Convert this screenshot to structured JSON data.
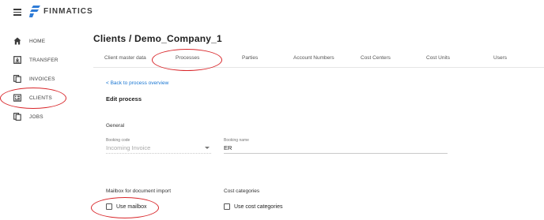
{
  "app": {
    "logo_text": "FINMATICS",
    "menu_icon": "hamburger-menu-icon",
    "logo_icon": "finmatics-logo-icon",
    "brand_color": "#2e7bd6"
  },
  "sidebar": {
    "items": [
      {
        "label": "HOME",
        "icon": "home-icon"
      },
      {
        "label": "TRANSFER",
        "icon": "transfer-icon"
      },
      {
        "label": "INVOICES",
        "icon": "invoices-icon"
      },
      {
        "label": "CLIENTS",
        "icon": "clients-icon"
      },
      {
        "label": "JOBS",
        "icon": "jobs-icon"
      }
    ]
  },
  "header": {
    "title": "Clients / Demo_Company_1"
  },
  "tabs": [
    {
      "label": "Client master data"
    },
    {
      "label": "Processes"
    },
    {
      "label": "Parties"
    },
    {
      "label": "Account Numbers"
    },
    {
      "label": "Cost Centers"
    },
    {
      "label": "Cost Units"
    },
    {
      "label": "Users"
    }
  ],
  "main": {
    "back_link": "< Back to process overview",
    "section_title": "Edit process",
    "general": {
      "heading": "General",
      "booking_code_label": "Booking code",
      "booking_code_value": "Incoming Invoice",
      "booking_name_label": "Booking name",
      "booking_name_value": "ER"
    },
    "mailbox": {
      "heading": "Mailbox for document import",
      "checkbox_label": "Use mailbox",
      "checked": false
    },
    "cost_categories": {
      "heading": "Cost categories",
      "checkbox_label": "Use cost categories",
      "checked": false
    }
  },
  "annotation_color": "#d9262a"
}
